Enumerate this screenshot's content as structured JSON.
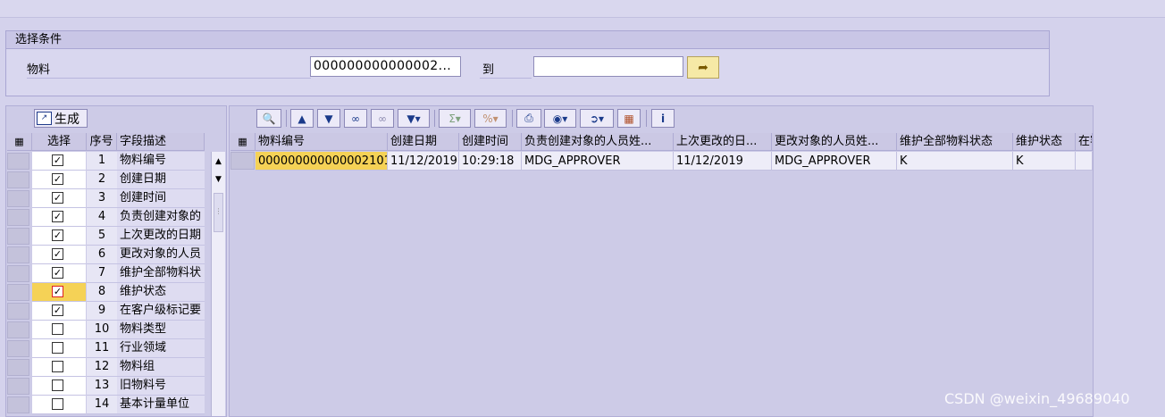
{
  "selection": {
    "title": "选择条件",
    "material_label": "物料",
    "from_value": "000000000000002...",
    "to_label": "到",
    "to_value": "",
    "multi_icon": "arrow-right-icon"
  },
  "left_panel": {
    "generate_label": "生成",
    "headers": {
      "select": "选择",
      "seq": "序号",
      "desc": "字段描述"
    },
    "rows": [
      {
        "seq": "1",
        "desc": "物料编号",
        "checked": true
      },
      {
        "seq": "2",
        "desc": "创建日期",
        "checked": true
      },
      {
        "seq": "3",
        "desc": "创建时间",
        "checked": true
      },
      {
        "seq": "4",
        "desc": "负责创建对象的",
        "checked": true
      },
      {
        "seq": "5",
        "desc": "上次更改的日期",
        "checked": true
      },
      {
        "seq": "6",
        "desc": "更改对象的人员",
        "checked": true
      },
      {
        "seq": "7",
        "desc": "维护全部物料状",
        "checked": true
      },
      {
        "seq": "8",
        "desc": "维护状态",
        "checked": true
      },
      {
        "seq": "9",
        "desc": "在客户级标记要",
        "checked": true
      },
      {
        "seq": "10",
        "desc": "物料类型",
        "checked": false
      },
      {
        "seq": "11",
        "desc": "行业领域",
        "checked": false
      },
      {
        "seq": "12",
        "desc": "物料组",
        "checked": false
      },
      {
        "seq": "13",
        "desc": "旧物料号",
        "checked": false
      },
      {
        "seq": "14",
        "desc": "基本计量单位",
        "checked": false
      }
    ]
  },
  "result_table": {
    "columns": [
      "物料编号",
      "创建日期",
      "创建时间",
      "负责创建对象的人员姓...",
      "上次更改的日...",
      "更改对象的人员姓...",
      "维护全部物料状态",
      "维护状态",
      "在客"
    ],
    "rows": [
      [
        "000000000000002101",
        "11/12/2019",
        "10:29:18",
        "MDG_APPROVER",
        "11/12/2019",
        "MDG_APPROVER",
        "K",
        "K",
        ""
      ]
    ]
  },
  "watermark": "CSDN @weixin_49689040",
  "colors": {
    "highlight": "#f5d256",
    "panel": "#cdcbe7",
    "background": "#d4d2ec"
  }
}
